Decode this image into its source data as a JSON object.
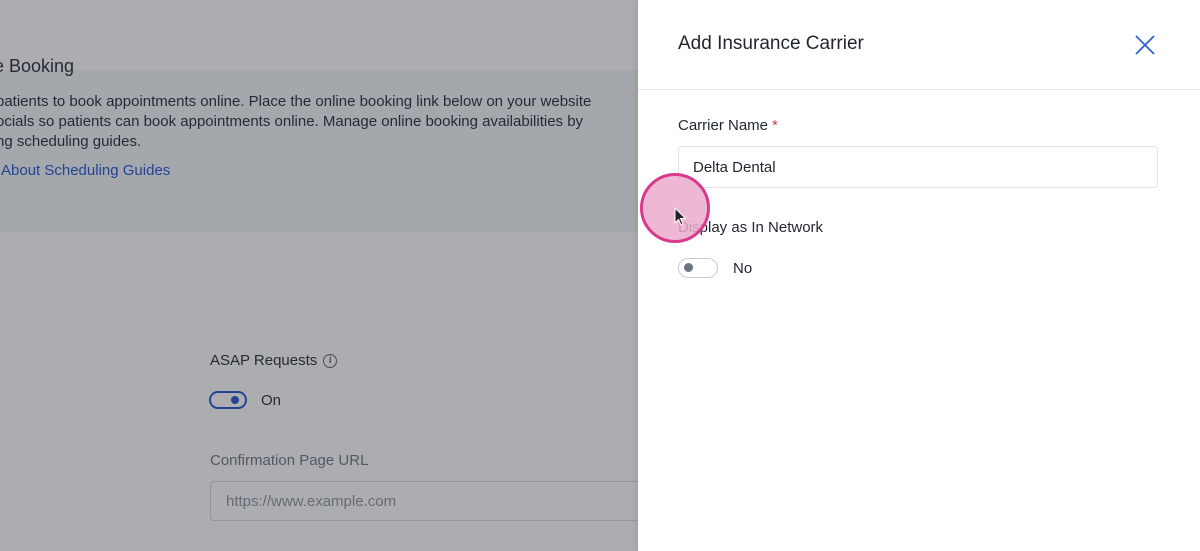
{
  "background": {
    "section_title": "e Booking",
    "description_lines": [
      "patients to book appointments online. Place the online booking link below on your website",
      "ocials so patients can book appointments online. Manage online booking availabilities by",
      "ng scheduling guides."
    ],
    "learn_link": "About Scheduling Guides",
    "asap_label": "ASAP Requests",
    "asap_info_icon": "info-icon",
    "asap_toggle_text": "On",
    "asap_enabled": true,
    "confirmation_label": "Confirmation Page URL",
    "confirmation_placeholder": "https://www.example.com"
  },
  "drawer": {
    "title": "Add Insurance Carrier",
    "close_icon": "close-icon",
    "carrier_name_label": "Carrier Name",
    "required_marker": "*",
    "carrier_name_value": "Delta Dental",
    "network_label": "Display as In Network",
    "network_toggle_text": "No",
    "network_enabled": false
  },
  "colors": {
    "accent": "#1f4fd0",
    "required": "#d6374b",
    "cursor_ring": "#d93a8c"
  }
}
